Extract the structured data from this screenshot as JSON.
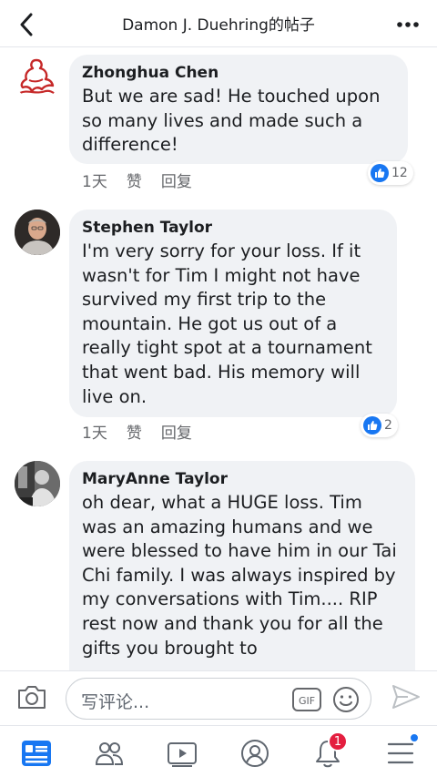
{
  "header": {
    "title": "Damon J. Duehring的帖子",
    "back_icon": "chevron-left-icon",
    "more_icon": "more-horizontal-icon"
  },
  "comments": [
    {
      "author": "Zhonghua Chen",
      "text": "But we are sad! He touched upon so many lives and made such a difference!",
      "time": "1天",
      "like_label": "赞",
      "reply_label": "回复",
      "likes": "12"
    },
    {
      "author": "Stephen Taylor",
      "text": "I'm very sorry for your loss.  If it wasn't for Tim I might not have survived my first trip to the mountain.  He got us out of a really tight spot at a tournament that went bad.  His memory will live on.",
      "time": "1天",
      "like_label": "赞",
      "reply_label": "回复",
      "likes": "2"
    },
    {
      "author": "MaryAnne Taylor",
      "text": "oh dear, what a HUGE loss.  Tim was an amazing humans and we were blessed to have him in our Tai Chi family.  I was always inspired by my conversations with Tim.... RIP rest now and thank you for all the gifts you brought to"
    }
  ],
  "composer": {
    "placeholder": "写评论...",
    "gif_label": "GIF"
  },
  "bottom_nav": {
    "notifications_badge": "1"
  },
  "colors": {
    "accent": "#1877f2",
    "bubble": "#f0f2f5",
    "badge": "#e41e3f"
  }
}
